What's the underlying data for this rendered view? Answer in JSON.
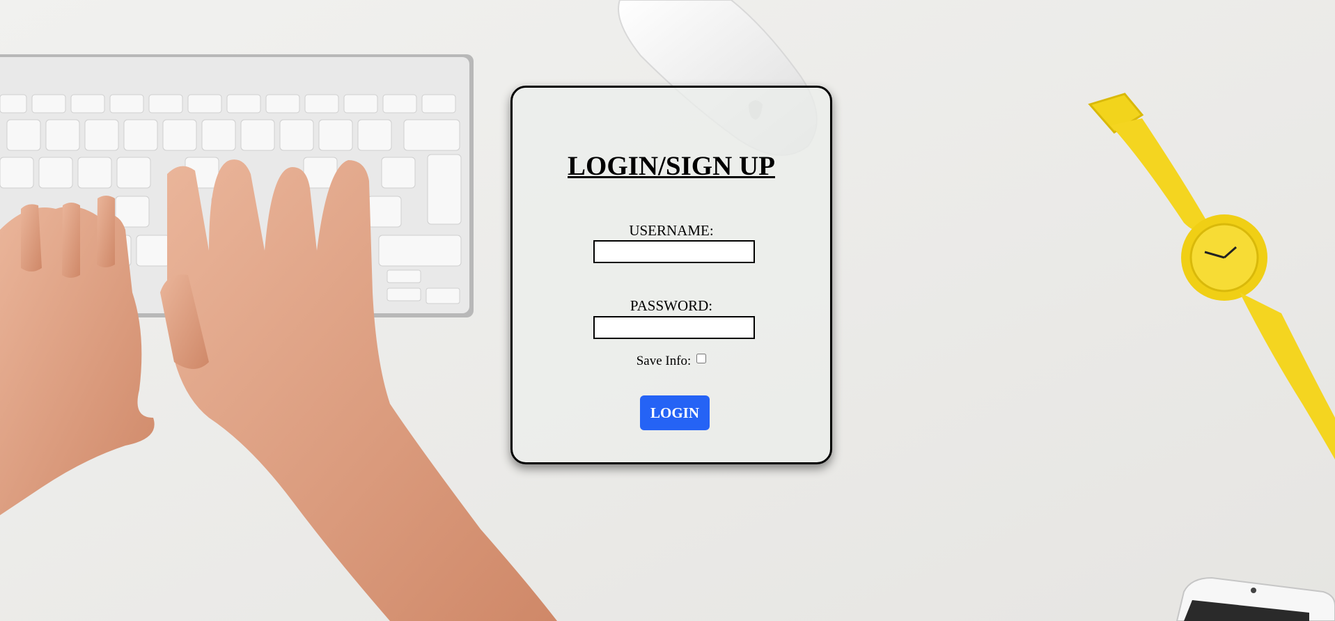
{
  "card": {
    "title": "LOGIN/SIGN UP",
    "username_label": "USERNAME:",
    "username_value": "",
    "password_label": "PASSWORD:",
    "password_value": "",
    "save_info_label": "Save Info:",
    "save_info_checked": false,
    "login_button_label": "LOGIN"
  },
  "colors": {
    "login_button": "#2563f5",
    "card_border": "#000000",
    "desk_surface": "#ecebe8",
    "watch": "#f2d41c",
    "skin": "#e2a487"
  },
  "background": {
    "description_icons": [
      "keyboard-icon",
      "hand-icon",
      "mouse-icon",
      "watch-icon",
      "phone-icon"
    ]
  }
}
